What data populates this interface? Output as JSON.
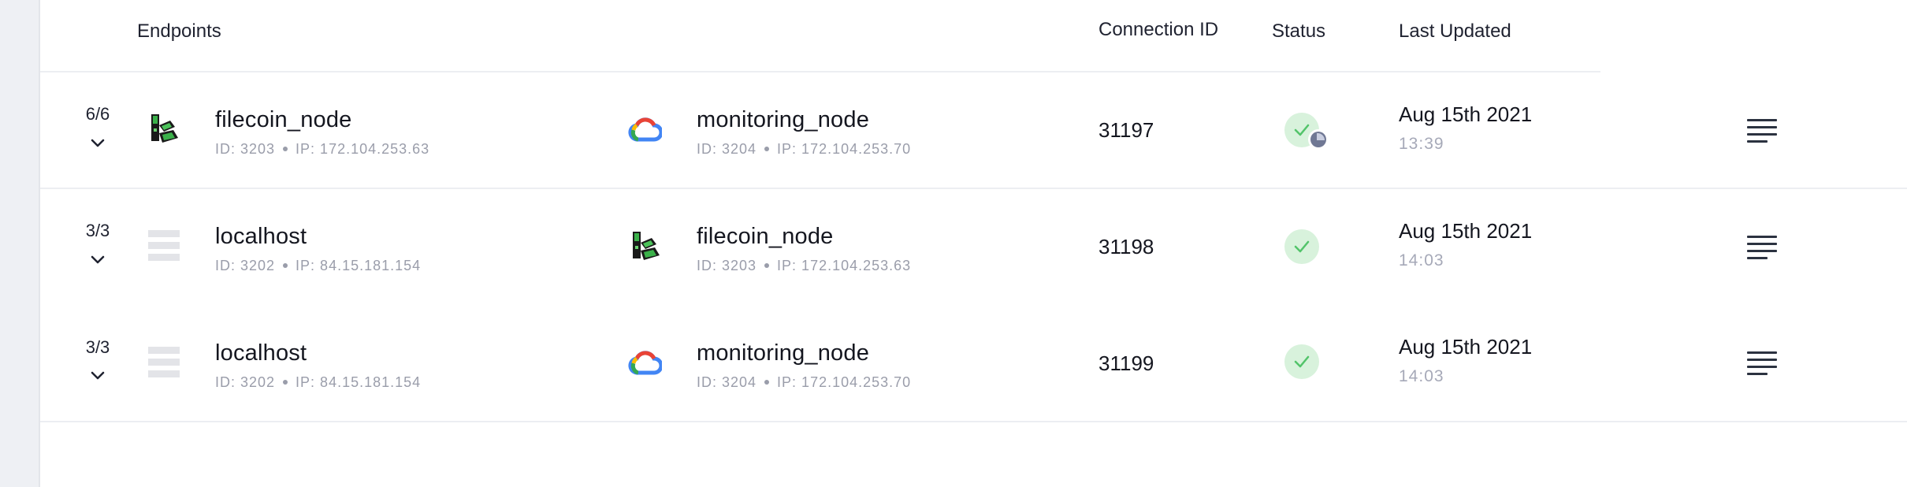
{
  "header": {
    "endpoints": "Endpoints",
    "connection_id": "Connection ID",
    "status": "Status",
    "last_updated": "Last Updated"
  },
  "rows": [
    {
      "count": "6/6",
      "source": {
        "name": "filecoin_node",
        "id": "ID: 3203",
        "ip": "IP: 172.104.253.63",
        "icon": "filecoin-node-icon"
      },
      "target": {
        "name": "monitoring_node",
        "id": "ID: 3204",
        "ip": "IP: 172.104.253.70",
        "icon": "google-cloud-icon"
      },
      "connection_id": "31197",
      "status": "ok-pending",
      "date": "Aug 15th 2021",
      "time": "13:39"
    },
    {
      "count": "3/3",
      "source": {
        "name": "localhost",
        "id": "ID: 3202",
        "ip": "IP: 84.15.181.154",
        "icon": "server-stack-icon"
      },
      "target": {
        "name": "filecoin_node",
        "id": "ID: 3203",
        "ip": "IP: 172.104.253.63",
        "icon": "filecoin-node-icon"
      },
      "connection_id": "31198",
      "status": "ok",
      "date": "Aug 15th 2021",
      "time": "14:03"
    },
    {
      "count": "3/3",
      "source": {
        "name": "localhost",
        "id": "ID: 3202",
        "ip": "IP: 84.15.181.154",
        "icon": "server-stack-icon"
      },
      "target": {
        "name": "monitoring_node",
        "id": "ID: 3204",
        "ip": "IP: 172.104.253.70",
        "icon": "google-cloud-icon"
      },
      "connection_id": "31199",
      "status": "ok",
      "date": "Aug 15th 2021",
      "time": "14:03"
    }
  ],
  "colors": {
    "status_ok_bg": "#d8f2dc",
    "status_ok_check": "#52c46a",
    "pending_clock": "#707894",
    "text_primary": "#14161f",
    "text_muted": "#9a9daa"
  }
}
